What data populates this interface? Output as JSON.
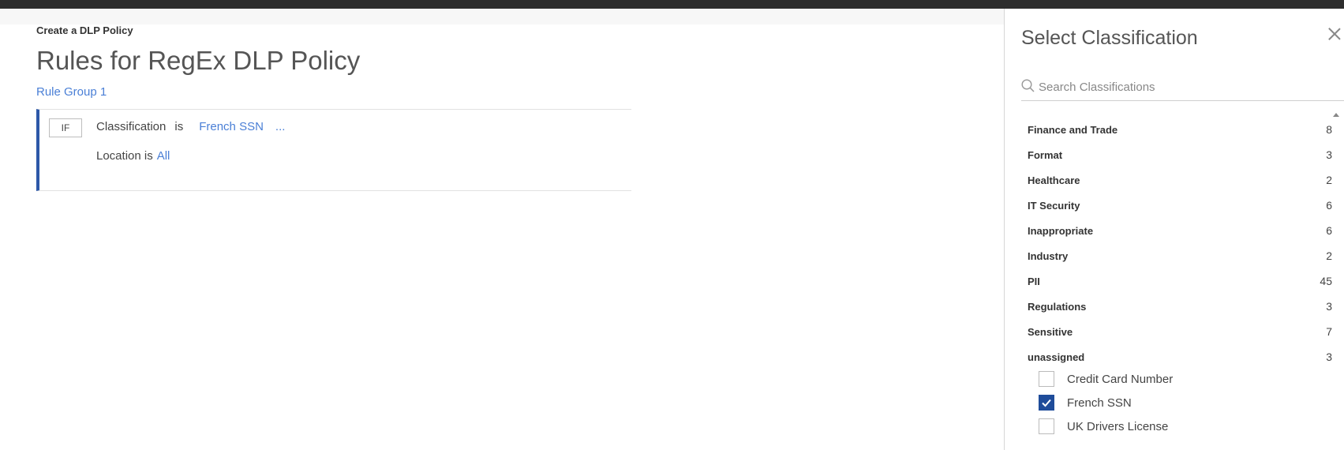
{
  "breadcrumb": "Create a DLP Policy",
  "page_title": "Rules for RegEx DLP Policy",
  "rule_group_label": "Rule Group 1",
  "rule": {
    "if_label": "IF",
    "condition1": {
      "field": "Classification",
      "operator": "is",
      "value": "French SSN",
      "more": "..."
    },
    "condition2": {
      "field_operator": "Location is",
      "value": "All"
    }
  },
  "panel": {
    "title": "Select Classification",
    "search_placeholder": "Search Classifications",
    "categories": [
      {
        "name": "Finance and Trade",
        "count": "8"
      },
      {
        "name": "Format",
        "count": "3"
      },
      {
        "name": "Healthcare",
        "count": "2"
      },
      {
        "name": "IT Security",
        "count": "6"
      },
      {
        "name": "Inappropriate",
        "count": "6"
      },
      {
        "name": "Industry",
        "count": "2"
      },
      {
        "name": "PII",
        "count": "45"
      },
      {
        "name": "Regulations",
        "count": "3"
      },
      {
        "name": "Sensitive",
        "count": "7"
      },
      {
        "name": "unassigned",
        "count": "3"
      }
    ],
    "unassigned_items": [
      {
        "label": "Credit Card Number",
        "checked": false
      },
      {
        "label": "French SSN",
        "checked": true
      },
      {
        "label": "UK Drivers License",
        "checked": false
      }
    ]
  },
  "colors": {
    "accent": "#4a7fd6",
    "rule_bar": "#2d58a8",
    "checkbox_checked": "#1f4c9a",
    "topbar": "#2d2d2d"
  }
}
